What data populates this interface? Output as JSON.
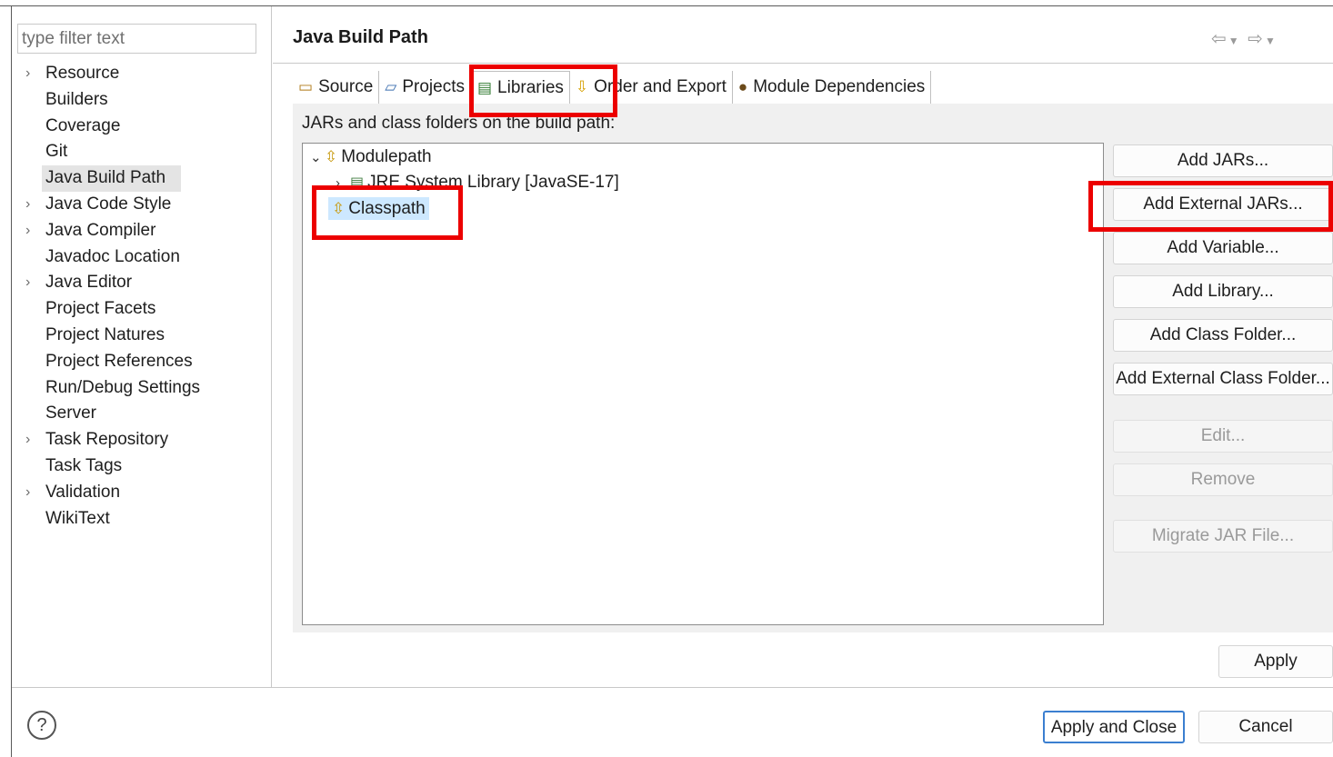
{
  "filter": {
    "placeholder": "type filter text"
  },
  "nav": {
    "items": [
      {
        "label": "Resource",
        "expandable": true
      },
      {
        "label": "Builders",
        "expandable": false
      },
      {
        "label": "Coverage",
        "expandable": false
      },
      {
        "label": "Git",
        "expandable": false
      },
      {
        "label": "Java Build Path",
        "expandable": false,
        "selected": true
      },
      {
        "label": "Java Code Style",
        "expandable": true
      },
      {
        "label": "Java Compiler",
        "expandable": true
      },
      {
        "label": "Javadoc Location",
        "expandable": false
      },
      {
        "label": "Java Editor",
        "expandable": true
      },
      {
        "label": "Project Facets",
        "expandable": false
      },
      {
        "label": "Project Natures",
        "expandable": false
      },
      {
        "label": "Project References",
        "expandable": false
      },
      {
        "label": "Run/Debug Settings",
        "expandable": false
      },
      {
        "label": "Server",
        "expandable": false
      },
      {
        "label": "Task Repository",
        "expandable": true
      },
      {
        "label": "Task Tags",
        "expandable": false
      },
      {
        "label": "Validation",
        "expandable": true
      },
      {
        "label": "WikiText",
        "expandable": false
      }
    ]
  },
  "page": {
    "title": "Java Build Path",
    "tabs": [
      {
        "label": "Source",
        "icon": "source-folder-icon"
      },
      {
        "label": "Projects",
        "icon": "projects-folder-icon"
      },
      {
        "label": "Libraries",
        "icon": "libraries-icon",
        "active": true
      },
      {
        "label": "Order and Export",
        "icon": "order-export-icon"
      },
      {
        "label": "Module Dependencies",
        "icon": "module-icon"
      }
    ],
    "section_label": "JARs and class folders on the build path:",
    "tree": {
      "modulepath": "Modulepath",
      "jre": "JRE System Library [JavaSE-17]",
      "classpath": "Classpath"
    },
    "buttons": {
      "add_jars": "Add JARs...",
      "add_external_jars": "Add External JARs...",
      "add_variable": "Add Variable...",
      "add_library": "Add Library...",
      "add_class_folder": "Add Class Folder...",
      "add_external_class_folder": "Add External Class Folder...",
      "edit": "Edit...",
      "remove": "Remove",
      "migrate_jar": "Migrate JAR File...",
      "apply": "Apply"
    }
  },
  "footer": {
    "help": "?",
    "apply_and_close": "Apply and Close",
    "cancel": "Cancel"
  }
}
